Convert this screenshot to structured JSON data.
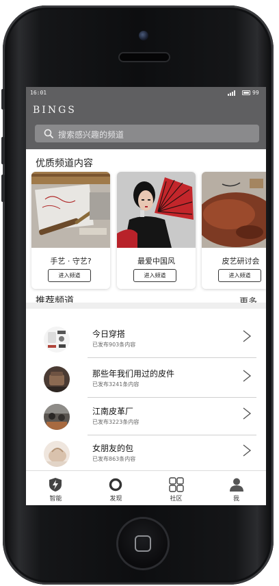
{
  "status_bar": {
    "time": "16:01",
    "battery": "99"
  },
  "header": {
    "brand": "BINGS",
    "search_placeholder": "搜索感兴趣的频道"
  },
  "featured": {
    "title": "优质频道内容",
    "enter_label": "进入频道",
    "cards": [
      {
        "name": "手艺 · 守艺?"
      },
      {
        "name": "最爱中国风"
      },
      {
        "name": "皮艺研讨会"
      }
    ]
  },
  "recommended": {
    "title": "推荐频道",
    "more_label": "更多",
    "items": [
      {
        "title": "今日穿搭",
        "count": "已发布903条内容"
      },
      {
        "title": "那些年我们用过的皮件",
        "count": "已发布3241条内容"
      },
      {
        "title": "江南皮革厂",
        "count": "已发布3223条内容"
      },
      {
        "title": "女朋友的包",
        "count": "已发布863条内容"
      }
    ]
  },
  "tabbar": {
    "tabs": [
      {
        "label": "智能",
        "icon": "shield-bolt-icon"
      },
      {
        "label": "发现",
        "icon": "ring-icon"
      },
      {
        "label": "社区",
        "icon": "grid-icon"
      },
      {
        "label": "我",
        "icon": "person-icon"
      }
    ]
  }
}
